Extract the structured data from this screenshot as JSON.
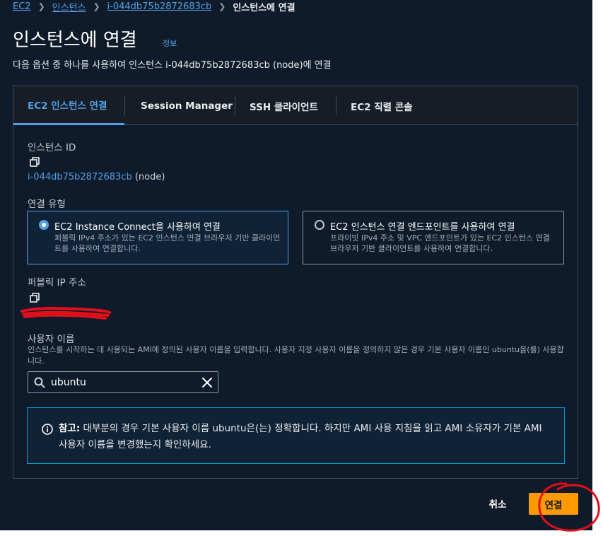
{
  "breadcrumb": {
    "items": [
      "EC2",
      "인스턴스",
      "i-044db75b2872683cb"
    ],
    "current": "인스턴스에 연결"
  },
  "header": {
    "title": "인스턴스에 연결",
    "info_link": "정보",
    "description": "다음 옵션 중 하나를 사용하여 인스턴스 i-044db75b2872683cb (node)에 연결"
  },
  "tabs": [
    {
      "label": "EC2 인스턴스 연결",
      "active": true
    },
    {
      "label": "Session Manager",
      "active": false
    },
    {
      "label": "SSH 클라이언트",
      "active": false
    },
    {
      "label": "EC2 직렬 콘솔",
      "active": false
    }
  ],
  "instance": {
    "label": "인스턴스 ID",
    "id": "i-044db75b2872683cb",
    "name": "(node)"
  },
  "connection_type": {
    "label": "연결 유형",
    "options": [
      {
        "title": "EC2 Instance Connect을 사용하여 연결",
        "description": "퍼블릭 IPv4 주소가 있는 EC2 인스턴스 연결 브라우저 기반 클라이언트를 사용하여 연결합니다.",
        "selected": true
      },
      {
        "title": "EC2 인스턴스 연결 엔드포인트를 사용하여 연결",
        "description": "프라이빗 IPv4 주소 및 VPC 엔드포인트가 있는 EC2 인스턴스 연결 브라우저 기반 클라이언트를 사용하여 연결합니다.",
        "selected": false
      }
    ]
  },
  "public_ip": {
    "label": "퍼블릭 IP 주소"
  },
  "username": {
    "label": "사용자 이름",
    "description": "인스턴스를 시작하는 데 사용되는 AMI에 정의된 사용자 이름을 입력합니다. 사용자 지정 사용자 이름을 정의하지 않은 경우 기본 사용자 이름인 ubuntu을(를) 사용합니다.",
    "value": "ubuntu"
  },
  "alert": {
    "prefix": "참고:",
    "text": " 대부분의 경우 기본 사용자 이름 ubuntu은(는) 정확합니다. 하지만 AMI 사용 지침을 읽고 AMI 소유자가 기본 AMI 사용자 이름을 변경했는지 확인하세요."
  },
  "footer": {
    "cancel_label": "취소",
    "connect_label": "연결"
  },
  "colors": {
    "background": "#0f1b2a",
    "link": "#539fe5",
    "primary_button": "#ff9900",
    "info_border": "#0a97c9",
    "annotation": "#e0101b"
  },
  "icons": [
    "chevron-right-icon",
    "copy-icon",
    "search-icon",
    "close-icon",
    "info-icon"
  ]
}
